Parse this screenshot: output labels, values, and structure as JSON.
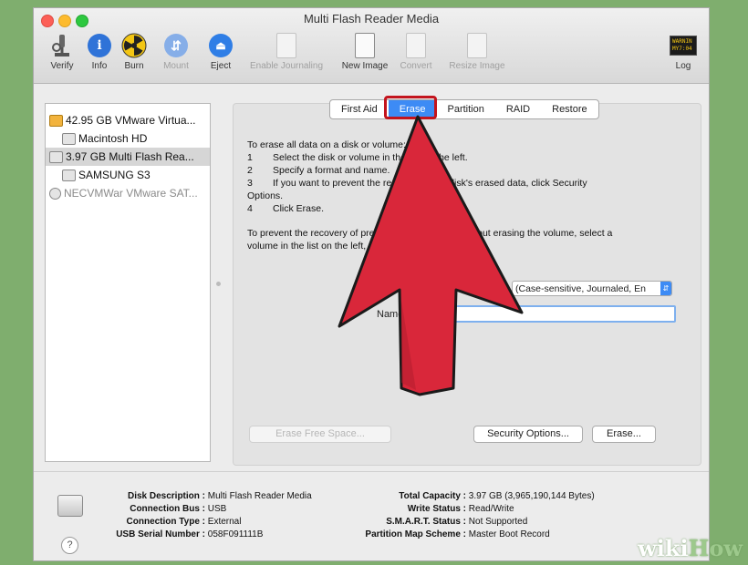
{
  "window": {
    "title": "Multi Flash Reader Media"
  },
  "toolbar": {
    "verify": "Verify",
    "info": "Info",
    "burn": "Burn",
    "mount": "Mount",
    "eject": "Eject",
    "enable_journaling": "Enable Journaling",
    "new_image": "New Image",
    "convert": "Convert",
    "resize_image": "Resize Image",
    "log": "Log",
    "log_icon_text": "WARNIN\nMY7:04"
  },
  "sidebar": {
    "items": [
      {
        "label": "42.95 GB VMware Virtua..."
      },
      {
        "label": "Macintosh HD"
      },
      {
        "label": "3.97 GB Multi Flash Rea..."
      },
      {
        "label": "SAMSUNG S3"
      },
      {
        "label": "NECVMWar VMware SAT..."
      }
    ]
  },
  "tabs": [
    "First Aid",
    "Erase",
    "Partition",
    "RAID",
    "Restore"
  ],
  "erase": {
    "line1": "To erase all data on a disk or volume:",
    "step1_num": "1",
    "step1": "Select the disk or volume in the list on the left.",
    "step2_num": "2",
    "step2": "Specify a format and name.",
    "step3_num": "3",
    "step3": "If you want to prevent the recovery of the disk's erased data, click Security",
    "step3_cont": "Options.",
    "step4_num": "4",
    "step4": "Click Erase.",
    "para2a": "To prevent the recovery of previously deleted files without erasing the volume, select a",
    "para2b": "volume in the list on the left, and click Erase Free Space.",
    "format_value": "(Case-sensitive, Journaled, En",
    "name_label": "Name:",
    "name_value": "",
    "erase_free_space": "Erase Free Space...",
    "security_options": "Security Options...",
    "erase_button": "Erase..."
  },
  "info": {
    "disk_description_label": "Disk Description :",
    "disk_description": "Multi Flash Reader Media",
    "connection_bus_label": "Connection Bus :",
    "connection_bus": "USB",
    "connection_type_label": "Connection Type :",
    "connection_type": "External",
    "usb_serial_label": "USB Serial Number :",
    "usb_serial": "058F091111B",
    "total_capacity_label": "Total Capacity :",
    "total_capacity": "3.97 GB (3,965,190,144 Bytes)",
    "write_status_label": "Write Status :",
    "write_status": "Read/Write",
    "smart_label": "S.M.A.R.T. Status :",
    "smart": "Not Supported",
    "partition_map_label": "Partition Map Scheme :",
    "partition_map": "Master Boot Record"
  },
  "help": "?",
  "watermark": {
    "part1": "wiki",
    "part2": "How"
  },
  "colors": {
    "accent": "#3d8bf5",
    "annotation_red": "#d9273a",
    "highlight_border": "#c3141d"
  }
}
